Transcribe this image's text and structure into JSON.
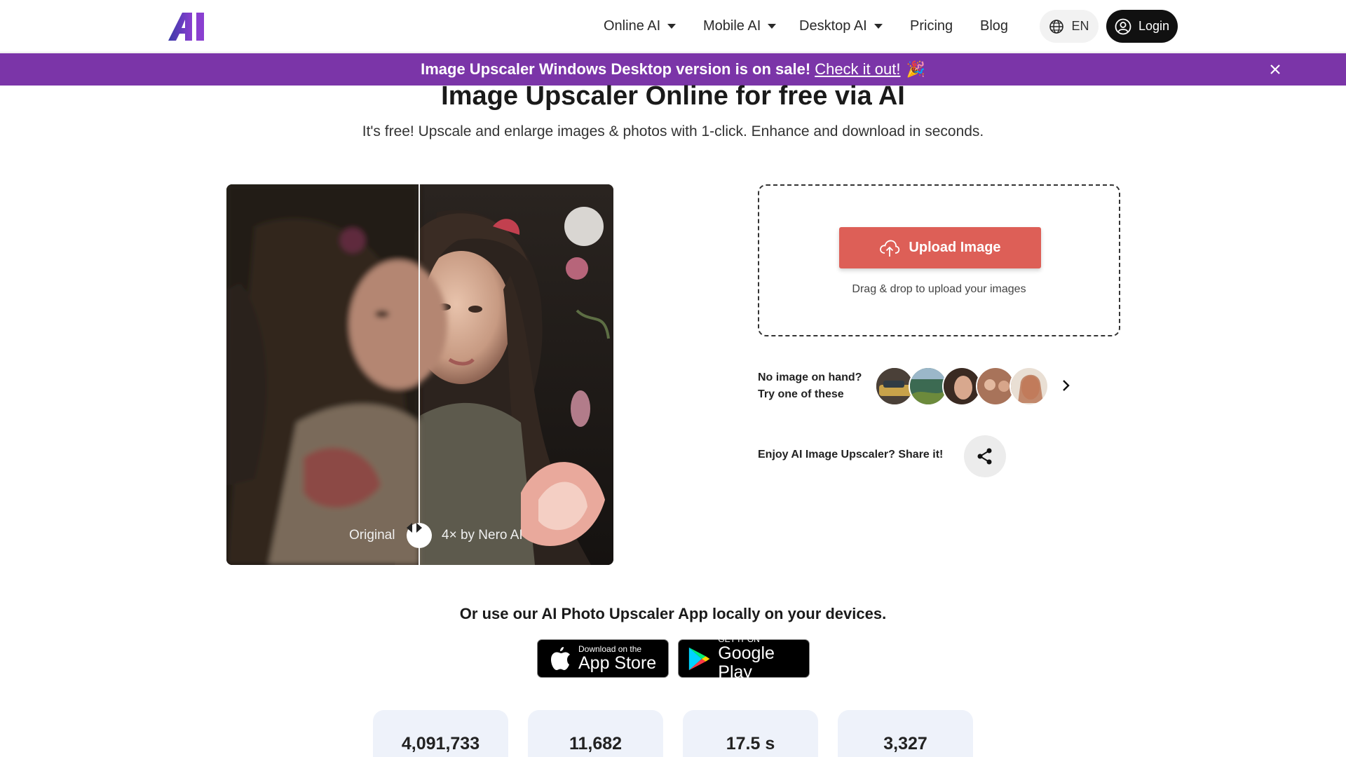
{
  "header": {
    "nav": [
      "Online AI",
      "Mobile AI",
      "Desktop AI",
      "Pricing",
      "Blog"
    ],
    "lang": "EN",
    "login": "Login"
  },
  "banner": {
    "text": "Image Upscaler Windows Desktop version is on sale!",
    "link": "Check it out!",
    "emoji": "🎉"
  },
  "hero": {
    "title": "Image Upscaler Online for free via AI",
    "subtitle": "It's free! Upscale and enlarge images & photos with 1-click. Enhance and download in seconds."
  },
  "compare": {
    "left_label": "Original",
    "right_label": "4× by Nero AI"
  },
  "upload": {
    "button": "Upload Image",
    "hint": "Drag & drop to upload your images"
  },
  "samples": {
    "line1": "No image on hand?",
    "line2": "Try one of these"
  },
  "share": {
    "label": "Enjoy AI Image Upscaler? Share it!"
  },
  "apps": {
    "title": "Or use our AI Photo Upscaler App locally on your devices.",
    "appstore_small": "Download on the",
    "appstore_big": "App Store",
    "googleplay_small": "GET IT ON",
    "googleplay_big": "Google Play"
  },
  "stats": [
    "4,091,733",
    "11,682",
    "17.5 s",
    "3,327"
  ],
  "colors": {
    "banner": "#7b35a8",
    "upload_button": "#dd5f57",
    "logo_gradient": [
      "#3a3aa8",
      "#8a3fd0"
    ]
  }
}
